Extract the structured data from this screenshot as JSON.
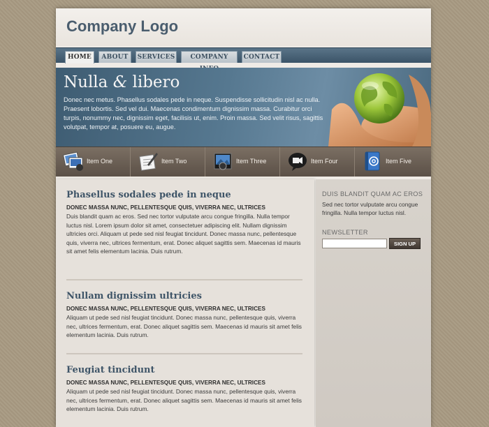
{
  "header": {
    "logo": "Company Logo"
  },
  "nav": {
    "items": [
      "HOME",
      "ABOUT",
      "SERVICES",
      "COMPANY INFO",
      "CONTACT"
    ]
  },
  "banner": {
    "title_part1": "Nulla ",
    "title_amp": "&",
    "title_part2": " libero",
    "text": "Donec nec metus. Phasellus sodales pede in neque. Suspendisse sollicitudin nisl ac nulla. Praesent lobortis. Sed vel dui. Maecenas condimentum dignissim massa. Curabitur orci turpis, nonummy nec, dignissim eget, facilisis ut, enim. Proin massa. Sed velit risus, sagittis volutpat, tempor at, posuere eu, augue."
  },
  "iconbar": {
    "items": [
      {
        "label": "Item One",
        "icon": "photos-icon"
      },
      {
        "label": "Item Two",
        "icon": "notepad-pen-icon"
      },
      {
        "label": "Item Three",
        "icon": "camera-icon"
      },
      {
        "label": "Item Four",
        "icon": "video-chat-icon"
      },
      {
        "label": "Item Five",
        "icon": "address-book-icon"
      }
    ]
  },
  "posts": [
    {
      "title": "Phasellus sodales pede in neque",
      "subtitle": "DONEC MASSA NUNC, PELLENTESQUE QUIS, VIVERRA NEC, ULTRICES",
      "body": "Duis blandit quam ac eros. Sed nec tortor vulputate arcu congue fringilla. Nulla tempor luctus nisl. Lorem ipsum dolor sit amet, consectetuer adipiscing elit. Nullam dignissim ultricies orci. Aliquam ut pede sed nisl feugiat tincidunt. Donec massa nunc, pellentesque quis, viverra nec, ultrices fermentum, erat. Donec aliquet sagittis sem. Maecenas id mauris sit amet felis elementum lacinia. Duis rutrum."
    },
    {
      "title": "Nullam dignissim ultricies",
      "subtitle": "DONEC MASSA NUNC, PELLENTESQUE QUIS, VIVERRA NEC, ULTRICES",
      "body": "Aliquam ut pede sed nisl feugiat tincidunt. Donec massa nunc, pellentesque quis, viverra nec, ultrices fermentum, erat. Donec aliquet sagittis sem. Maecenas id mauris sit amet felis elementum lacinia. Duis rutrum."
    },
    {
      "title": "Feugiat tincidunt",
      "subtitle": "DONEC MASSA NUNC, PELLENTESQUE QUIS, VIVERRA NEC, ULTRICES",
      "body": "Aliquam ut pede sed nisl feugiat tincidunt. Donec massa nunc, pellentesque quis, viverra nec, ultrices fermentum, erat. Donec aliquet sagittis sem. Maecenas id mauris sit amet felis elementum lacinia. Duis rutrum."
    }
  ],
  "sidebar": {
    "heading": "DUIS BLANDIT QUAM AC EROS",
    "text": "Sed nec tortor vulputate arcu congue fringilla. Nulla tempor luctus nisl.",
    "newsletter_heading": "NEWSLETTER",
    "newsletter_value": "",
    "signup_label": "SIGN UP"
  },
  "colors": {
    "accent": "#4a5d6e",
    "nav_bar": "#3b5468",
    "icon_bar": "#5b5047",
    "page_bg": "#a89a82"
  }
}
